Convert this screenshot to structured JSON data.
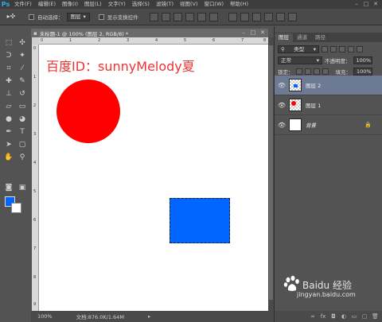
{
  "app": {
    "logo": "Ps",
    "menu": [
      "文件(F)",
      "编辑(E)",
      "图像(I)",
      "图层(L)",
      "文字(Y)",
      "选择(S)",
      "滤镜(T)",
      "视图(V)",
      "窗口(W)",
      "帮助(H)"
    ],
    "window_controls": [
      "–",
      "□",
      "✕"
    ]
  },
  "options_bar": {
    "tool_icon": "move-tool-icon",
    "auto_select_label": "自动选择：",
    "auto_select_value": "图层",
    "show_transform_label": "显示变换控件"
  },
  "document": {
    "tab_title": "未标题-1 @ 100% (图层 2, RGB/8) *",
    "tab_controls": [
      "–",
      "□",
      "✕"
    ],
    "canvas_text": "百度ID：sunnyMelody夏",
    "ruler_h_labels": [
      "0",
      "1",
      "2",
      "3",
      "4",
      "5",
      "6",
      "7",
      "8"
    ],
    "ruler_v_labels": [
      "0",
      "1",
      "2",
      "3",
      "4",
      "5",
      "6",
      "7",
      "8",
      "9"
    ],
    "zoom": "100%",
    "doc_info": "文档:876.0K/1.64M"
  },
  "colors": {
    "foreground": "#0066ff",
    "background": "#ffffff",
    "circle": "#ff0000",
    "rect": "#0066ff",
    "selected_layer": "#6c7a93"
  },
  "panel": {
    "tabs": [
      "图层",
      "通道",
      "路径"
    ],
    "filter_kind": "类型",
    "blend_mode": "正常",
    "opacity_label": "不透明度：",
    "opacity_value": "100%",
    "lock_label": "锁定：",
    "fill_label": "填充：",
    "fill_value": "100%",
    "layers": [
      {
        "name": "图层 2",
        "selected": true
      },
      {
        "name": "图层 1",
        "selected": false
      },
      {
        "name": "背景",
        "selected": false
      }
    ]
  },
  "watermark": {
    "brand": "Baidu 经验",
    "url": "jingyan.baidu.com"
  }
}
